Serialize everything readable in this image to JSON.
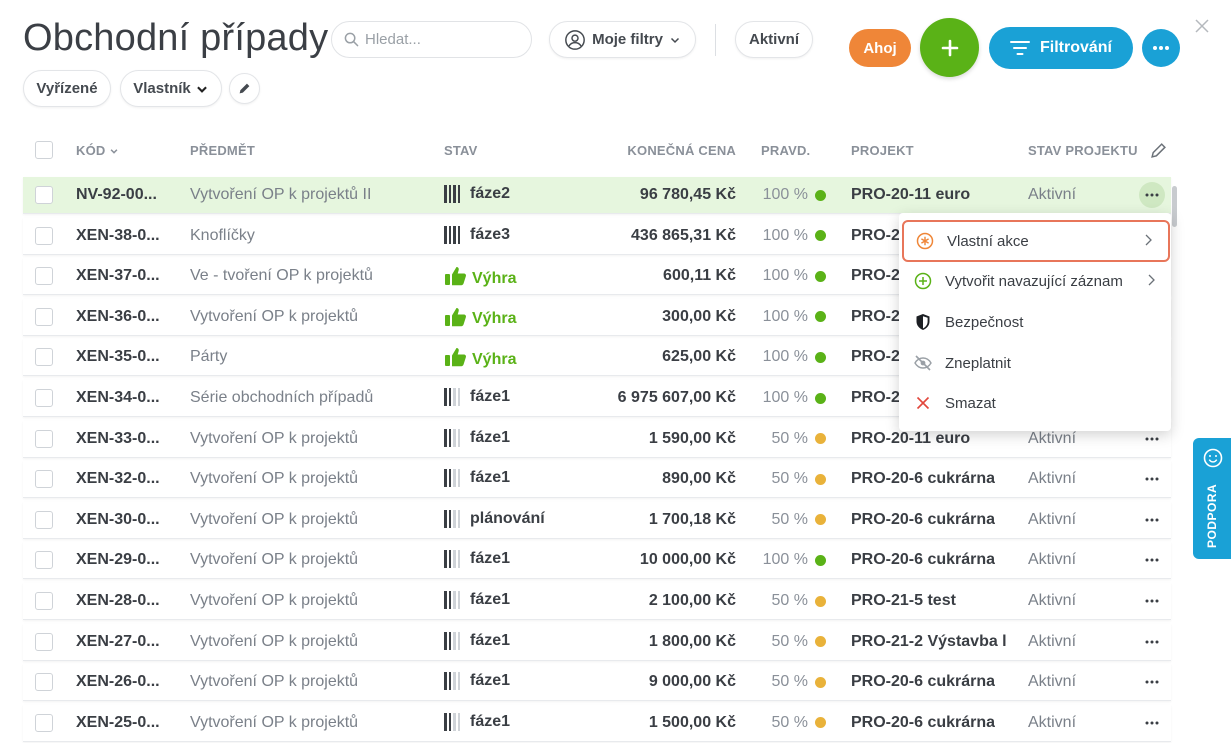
{
  "page": {
    "title": "Obchodní případy"
  },
  "search": {
    "placeholder": "Hledat..."
  },
  "toolbar": {
    "my_filters_label": "Moje filtry",
    "active_label": "Aktivní",
    "resolved_label": "Vyřízené",
    "owner_label": "Vlastník",
    "ahoj_label": "Ahoj",
    "filter_label": "Filtrování"
  },
  "colors": {
    "accent_blue": "#1aa1d6",
    "add_green": "#5ab217",
    "ahoj_orange": "#ef8638",
    "probability_high": "#5ab217",
    "probability_mid": "#e9b23a",
    "highlight_row": "#e6f6de",
    "menu_selected_border": "#e8765a"
  },
  "table": {
    "headers": {
      "code": "KÓD",
      "subject": "PŘEDMĚT",
      "status": "STAV",
      "price": "KONEČNÁ CENA",
      "probability": "PRAVD.",
      "project": "PROJEKT",
      "project_status": "STAV PROJEKTU"
    },
    "rows": [
      {
        "code": "NV-92-00...",
        "subject": "Vytvoření OP k projektů II",
        "status": "fáze2",
        "status_kind": "bars",
        "bars_filled": 4,
        "price": "96 780,45 Kč",
        "probability": "100 %",
        "prob_level": "high",
        "project": "PRO-20-11 euro",
        "project_status": "Aktivní",
        "highlighted": true
      },
      {
        "code": "XEN-38-0...",
        "subject": "Knoflíčky",
        "status": "fáze3",
        "status_kind": "bars",
        "bars_filled": 4,
        "price": "436 865,31 Kč",
        "probability": "100 %",
        "prob_level": "high",
        "project": "PRO-2",
        "project_status": ""
      },
      {
        "code": "XEN-37-0...",
        "subject": "Ve - tvoření OP k projektů",
        "status": "Výhra",
        "status_kind": "win",
        "price": "600,11 Kč",
        "probability": "100 %",
        "prob_level": "high",
        "project": "PRO-2",
        "project_status": ""
      },
      {
        "code": "XEN-36-0...",
        "subject": "Vytvoření OP k projektů",
        "status": "Výhra",
        "status_kind": "win",
        "price": "300,00 Kč",
        "probability": "100 %",
        "prob_level": "high",
        "project": "PRO-2",
        "project_status": ""
      },
      {
        "code": "XEN-35-0...",
        "subject": "Párty",
        "status": "Výhra",
        "status_kind": "win",
        "price": "625,00 Kč",
        "probability": "100 %",
        "prob_level": "high",
        "project": "PRO-2",
        "project_status": ""
      },
      {
        "code": "XEN-34-0...",
        "subject": "Série obchodních případů",
        "status": "fáze1",
        "status_kind": "bars",
        "bars_filled": 2,
        "price": "6 975 607,00 Kč",
        "probability": "100 %",
        "prob_level": "high",
        "project": "PRO-2",
        "project_status": ""
      },
      {
        "code": "XEN-33-0...",
        "subject": "Vytvoření OP k projektů",
        "status": "fáze1",
        "status_kind": "bars",
        "bars_filled": 2,
        "price": "1 590,00 Kč",
        "probability": "50 %",
        "prob_level": "mid",
        "project": "PRO-20-11 euro",
        "project_status": "Aktivní"
      },
      {
        "code": "XEN-32-0...",
        "subject": "Vytvoření OP k projektů",
        "status": "fáze1",
        "status_kind": "bars",
        "bars_filled": 2,
        "price": "890,00 Kč",
        "probability": "50 %",
        "prob_level": "mid",
        "project": "PRO-20-6 cukrárna",
        "project_status": "Aktivní"
      },
      {
        "code": "XEN-30-0...",
        "subject": "Vytvoření OP k projektů",
        "status": "plánování",
        "status_kind": "bars",
        "bars_filled": 2,
        "price": "1 700,18 Kč",
        "probability": "50 %",
        "prob_level": "mid",
        "project": "PRO-20-6 cukrárna",
        "project_status": "Aktivní"
      },
      {
        "code": "XEN-29-0...",
        "subject": "Vytvoření OP k projektů",
        "status": "fáze1",
        "status_kind": "bars",
        "bars_filled": 2,
        "price": "10 000,00 Kč",
        "probability": "100 %",
        "prob_level": "high",
        "project": "PRO-20-6 cukrárna",
        "project_status": "Aktivní"
      },
      {
        "code": "XEN-28-0...",
        "subject": "Vytvoření OP k projektů",
        "status": "fáze1",
        "status_kind": "bars",
        "bars_filled": 2,
        "price": "2 100,00 Kč",
        "probability": "50 %",
        "prob_level": "mid",
        "project": "PRO-21-5 test",
        "project_status": "Aktivní"
      },
      {
        "code": "XEN-27-0...",
        "subject": "Vytvoření OP k projektů",
        "status": "fáze1",
        "status_kind": "bars",
        "bars_filled": 2,
        "price": "1 800,00 Kč",
        "probability": "50 %",
        "prob_level": "mid",
        "project": "PRO-21-2 Výstavba l",
        "project_status": "Aktivní"
      },
      {
        "code": "XEN-26-0...",
        "subject": "Vytvoření OP k projektů",
        "status": "fáze1",
        "status_kind": "bars",
        "bars_filled": 2,
        "price": "9 000,00 Kč",
        "probability": "50 %",
        "prob_level": "mid",
        "project": "PRO-20-6 cukrárna",
        "project_status": "Aktivní"
      },
      {
        "code": "XEN-25-0...",
        "subject": "Vytvoření OP k projektů",
        "status": "fáze1",
        "status_kind": "bars",
        "bars_filled": 2,
        "price": "1 500,00 Kč",
        "probability": "50 %",
        "prob_level": "mid",
        "project": "PRO-20-6 cukrárna",
        "project_status": "Aktivní"
      }
    ]
  },
  "context_menu": {
    "items": [
      {
        "label": "Vlastní akce",
        "icon": "custom-action-icon",
        "has_submenu": true,
        "selected": true
      },
      {
        "label": "Vytvořit navazující záznam",
        "icon": "plus-circle-icon",
        "has_submenu": true
      },
      {
        "label": "Bezpečnost",
        "icon": "shield-icon"
      },
      {
        "label": "Zneplatnit",
        "icon": "eye-off-icon"
      },
      {
        "label": "Smazat",
        "icon": "close-icon"
      }
    ]
  },
  "support": {
    "label": "PODPORA"
  }
}
